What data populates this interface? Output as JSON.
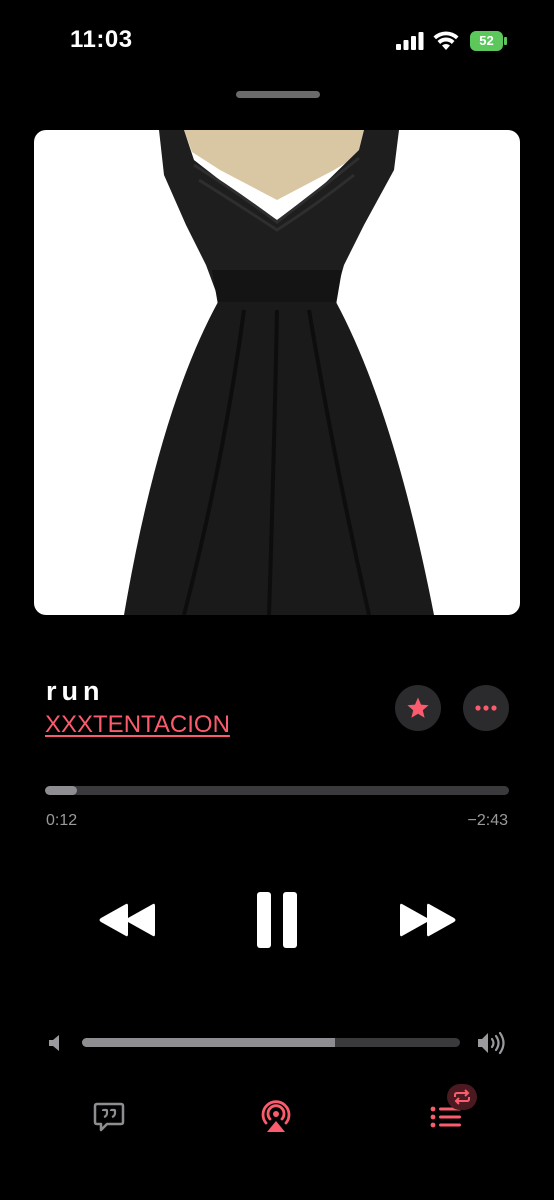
{
  "status_bar": {
    "time": "11:03",
    "battery_percent": "52",
    "signal_icon": "cellular-signal-icon",
    "wifi_icon": "wifi-icon"
  },
  "now_playing": {
    "artwork_description_icon": "album-artwork",
    "title": "run",
    "artist": "XXXTENTACION",
    "favorite_icon": "star-icon",
    "more_icon": "ellipsis-icon"
  },
  "progress": {
    "elapsed": "0:12",
    "remaining": "−2:43",
    "fraction": 0.068
  },
  "controls": {
    "rewind_icon": "rewind-icon",
    "pause_icon": "pause-icon",
    "forward_icon": "fast-forward-icon"
  },
  "volume": {
    "level": 0.67
  },
  "bottom_bar": {
    "lyrics_icon": "lyrics-quote-icon",
    "airplay_icon": "airplay-audio-icon",
    "queue_icon": "queue-list-icon",
    "repeat_icon": "repeat-icon"
  },
  "colors": {
    "accent": "#fa5c6d",
    "background": "#000000",
    "track": "#3a3a3c",
    "track_fill": "#8e8e92",
    "battery": "#5cc85c"
  }
}
